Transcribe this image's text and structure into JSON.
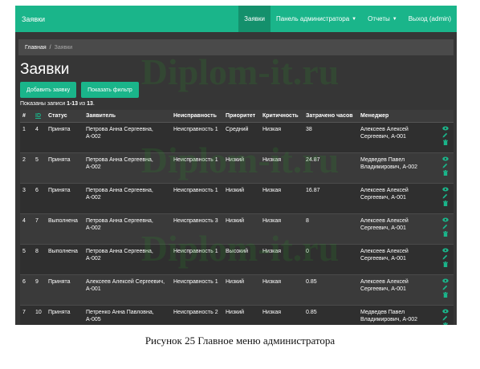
{
  "navbar": {
    "brand": "Заявки",
    "items": [
      {
        "label": "Заявки",
        "active": true,
        "dropdown": false
      },
      {
        "label": "Панель администратора",
        "active": false,
        "dropdown": true
      },
      {
        "label": "Отчеты",
        "active": false,
        "dropdown": true
      },
      {
        "label": "Выход (admin)",
        "active": false,
        "dropdown": false
      }
    ]
  },
  "breadcrumb": {
    "home": "Главная",
    "separator": "/",
    "current": "Заявки"
  },
  "page": {
    "title": "Заявки",
    "add_button": "Добавить заявку",
    "filter_button": "Показать фильтр",
    "summary_prefix": "Показаны записи ",
    "summary_range": "1-13",
    "summary_of": " из ",
    "summary_total": "13",
    "summary_suffix": "."
  },
  "table": {
    "headers": [
      "#",
      "ID",
      "Статус",
      "Заявитель",
      "Неисправность",
      "Приоритет",
      "Критичность",
      "Затрачено часов",
      "Менеджер"
    ],
    "rows": [
      {
        "num": "1",
        "id": "4",
        "status": "Принята",
        "applicant": "Петрова Анна Сергеевна, А-002",
        "fault": "Неисправность 1",
        "priority": "Средний",
        "criticality": "Низкая",
        "hours": "38",
        "manager": "Алексеев Алексей Сергеевич, А-001"
      },
      {
        "num": "2",
        "id": "5",
        "status": "Принята",
        "applicant": "Петрова Анна Сергеевна, А-002",
        "fault": "Неисправность 1",
        "priority": "Низкий",
        "criticality": "Низкая",
        "hours": "24.87",
        "manager": "Медведев Павел Владимирович, А-002"
      },
      {
        "num": "3",
        "id": "6",
        "status": "Принята",
        "applicant": "Петрова Анна Сергеевна, А-002",
        "fault": "Неисправность 1",
        "priority": "Низкий",
        "criticality": "Низкая",
        "hours": "16.87",
        "manager": "Алексеев Алексей Сергеевич, А-001"
      },
      {
        "num": "4",
        "id": "7",
        "status": "Выполнена",
        "applicant": "Петрова Анна Сергеевна, А-002",
        "fault": "Неисправность 3",
        "priority": "Низкий",
        "criticality": "Низкая",
        "hours": "8",
        "manager": "Алексеев Алексей Сергеевич, А-001"
      },
      {
        "num": "5",
        "id": "8",
        "status": "Выполнена",
        "applicant": "Петрова Анна Сергеевна, А-002",
        "fault": "Неисправность 1",
        "priority": "Высокий",
        "criticality": "Низкая",
        "hours": "0",
        "manager": "Алексеев Алексей Сергеевич, А-001"
      },
      {
        "num": "6",
        "id": "9",
        "status": "Принята",
        "applicant": "Алексеев Алексей Сергеевич, А-001",
        "fault": "Неисправность 1",
        "priority": "Низкий",
        "criticality": "Низкая",
        "hours": "0.85",
        "manager": "Алексеев Алексей Сергеевич, А-001"
      },
      {
        "num": "7",
        "id": "10",
        "status": "Принята",
        "applicant": "Петренко Анна Павловна, А-005",
        "fault": "Неисправность 2",
        "priority": "Низкий",
        "criticality": "Низкая",
        "hours": "0.85",
        "manager": "Медведев Павел Владимирович, А-002"
      }
    ]
  },
  "caption": "Рисунок 25 Главное меню администратора",
  "watermark": "Diplom-it.ru",
  "colors": {
    "accent": "#1ab58a",
    "accent_dark": "#14906c",
    "panel": "#363636"
  },
  "icons": [
    "eye-icon",
    "pencil-icon",
    "trash-icon"
  ]
}
